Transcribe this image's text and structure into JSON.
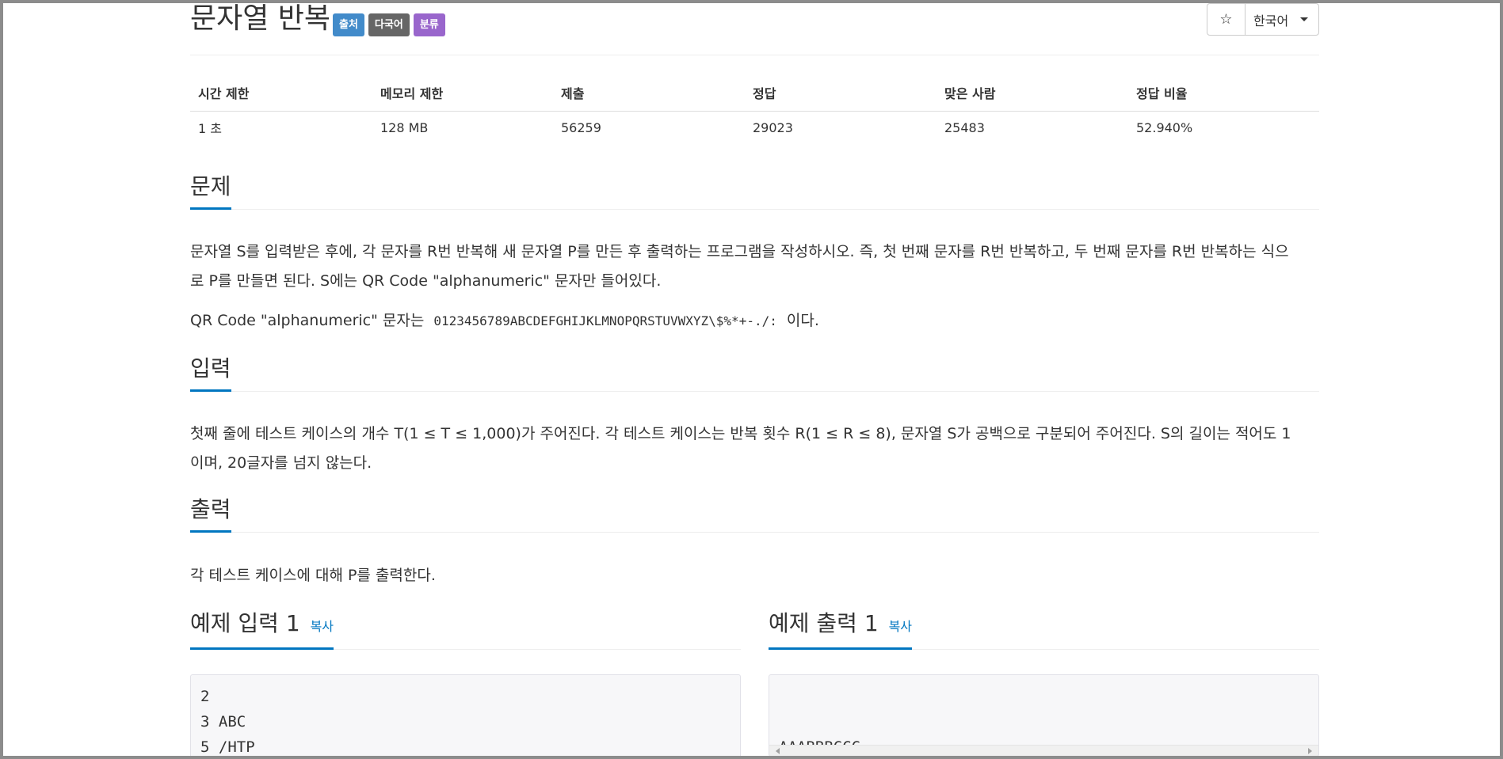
{
  "problem": {
    "title": "문자열 반복",
    "badges": [
      "출처",
      "다국어",
      "분류"
    ],
    "star_icon": "☆",
    "language": "한국어"
  },
  "stats": {
    "headers": [
      "시간 제한",
      "메모리 제한",
      "제출",
      "정답",
      "맞은 사람",
      "정답 비율"
    ],
    "values": [
      "1 초",
      "128 MB",
      "56259",
      "29023",
      "25483",
      "52.940%"
    ]
  },
  "sections": {
    "problem_heading": "문제",
    "problem_p1_line1": "문자열 S를 입력받은 후에, 각 문자를 R번 반복해 새 문자열 P를 만든 후 출력하는 프로그램을 작성하시오. 즉, 첫 번째 문자를 R번 반복하고, 두 번째 문자를 R번 반복하는 식으",
    "problem_p1_line2": "로 P를 만들면 된다. S에는 QR Code \"alphanumeric\" 문자만 들어있다.",
    "problem_p2_prefix": "QR Code \"alphanumeric\" 문자는",
    "problem_p2_code": "0123456789ABCDEFGHIJKLMNOPQRSTUVWXYZ\\$%*+-./:",
    "problem_p2_suffix": "이다.",
    "input_heading": "입력",
    "input_line1": "첫째 줄에 테스트 케이스의 개수 T(1 ≤ T ≤ 1,000)가 주어진다. 각 테스트 케이스는 반복 횟수 R(1 ≤ R ≤ 8), 문자열 S가 공백으로 구분되어 주어진다. S의 길이는 적어도 1",
    "input_line2": "이며, 20글자를 넘지 않는다.",
    "output_heading": "출력",
    "output_text": "각 테스트 케이스에 대해 P를 출력한다.",
    "sample_input_heading": "예제 입력 1",
    "sample_output_heading": "예제 출력 1",
    "copy_label": "복사",
    "sample_input": "2\n3 ABC\n5 /HTP",
    "sample_output": "AAABBBCCC\n/////HHHHHTTTTTPPPPP"
  }
}
